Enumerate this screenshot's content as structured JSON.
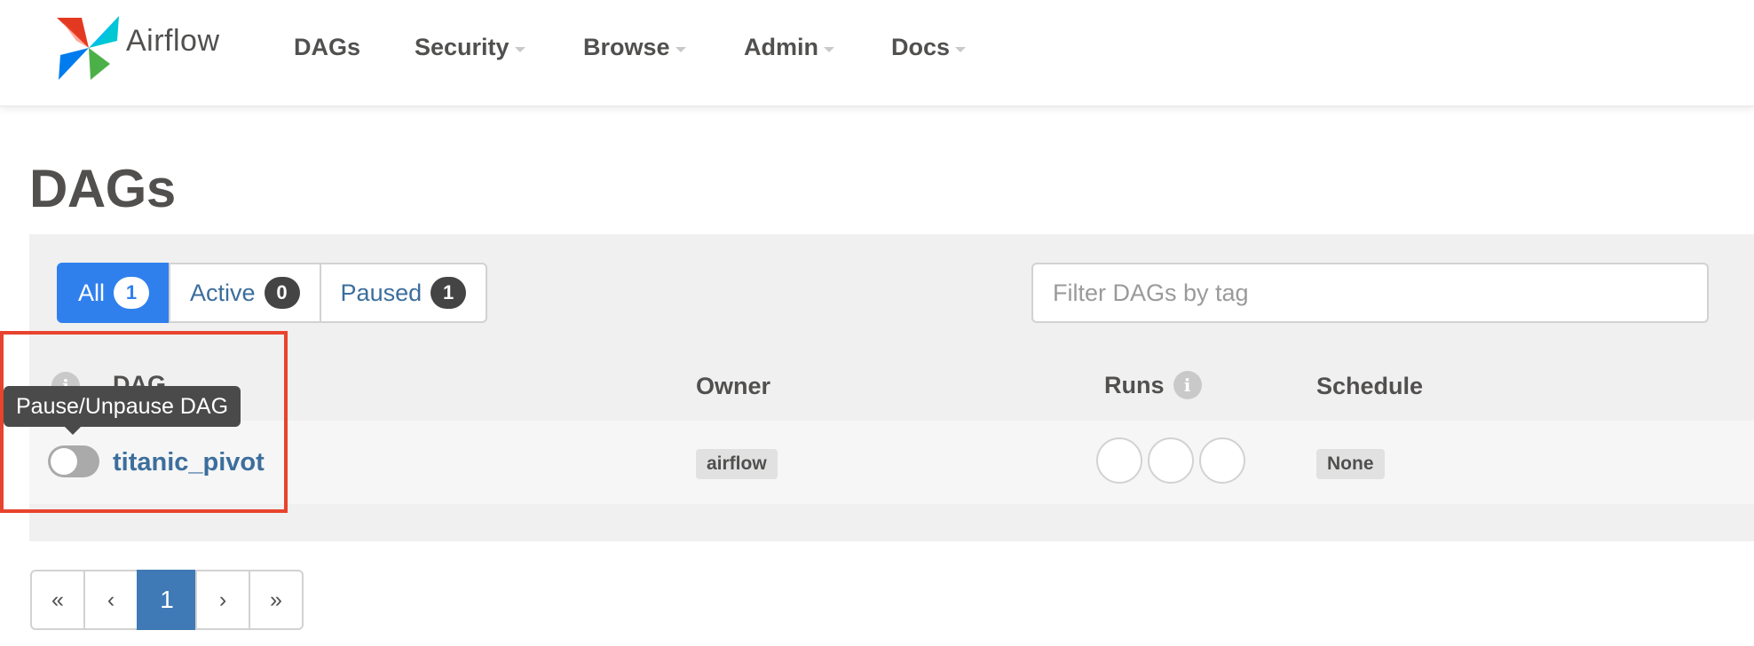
{
  "navbar": {
    "brand": "Airflow",
    "items": [
      {
        "label": "DAGs",
        "has_caret": false
      },
      {
        "label": "Security",
        "has_caret": true
      },
      {
        "label": "Browse",
        "has_caret": true
      },
      {
        "label": "Admin",
        "has_caret": true
      },
      {
        "label": "Docs",
        "has_caret": true
      }
    ]
  },
  "page": {
    "title": "DAGs"
  },
  "status_filter": {
    "all": {
      "label": "All",
      "count": "1"
    },
    "active": {
      "label": "Active",
      "count": "0"
    },
    "paused": {
      "label": "Paused",
      "count": "1"
    }
  },
  "tag_filter": {
    "placeholder": "Filter DAGs by tag",
    "value": ""
  },
  "table": {
    "headers": {
      "dag": "DAG",
      "owner": "Owner",
      "runs": "Runs",
      "schedule": "Schedule"
    },
    "info_glyph": "i",
    "rows": [
      {
        "dag_id": "titanic_pivot",
        "owner": "airflow",
        "schedule": "None",
        "paused": true,
        "runs": [
          "",
          "",
          ""
        ]
      }
    ]
  },
  "tooltip": {
    "text": "Pause/Unpause DAG"
  },
  "pagination": {
    "first": "«",
    "prev": "‹",
    "current": "1",
    "next": "›",
    "last": "»"
  },
  "colors": {
    "accent": "#2f80ed",
    "link": "#3c6e9c",
    "highlight": "#e8432d",
    "pagination_active": "#3f79b6"
  }
}
